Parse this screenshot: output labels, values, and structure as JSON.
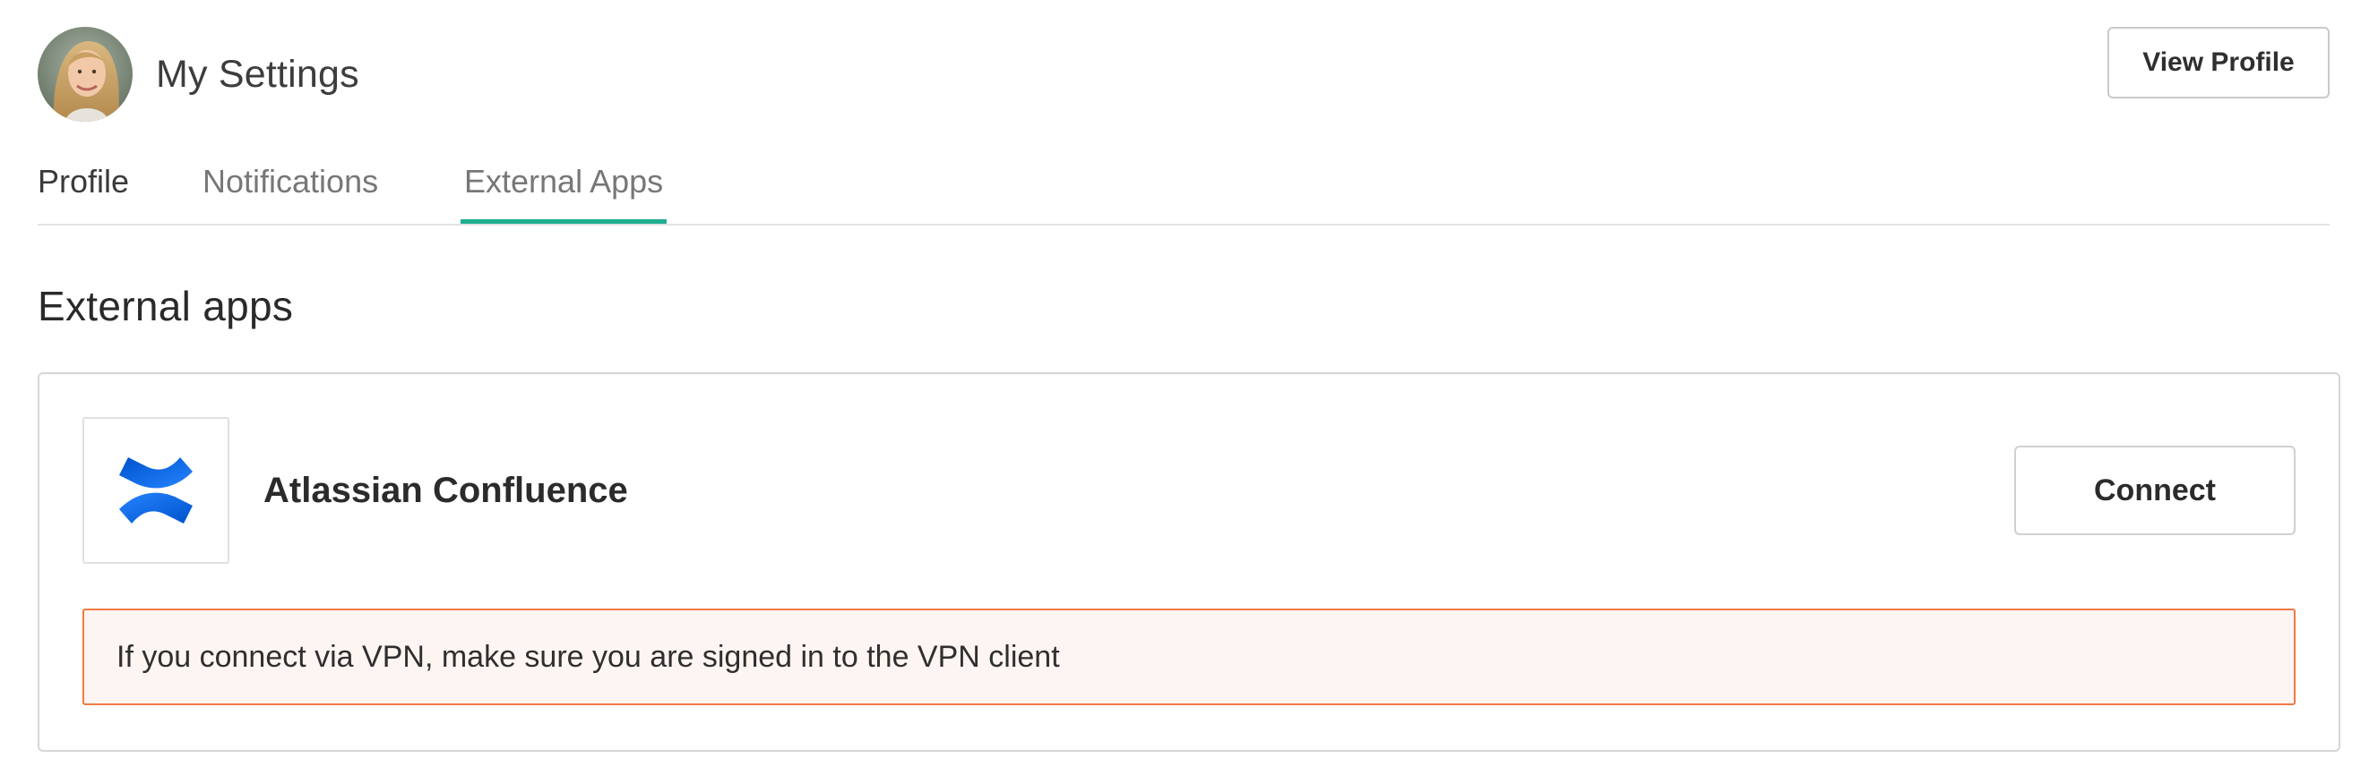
{
  "header": {
    "title": "My Settings",
    "view_profile_label": "View Profile"
  },
  "tabs": [
    {
      "label": "Profile",
      "active": false
    },
    {
      "label": "Notifications",
      "active": false
    },
    {
      "label": "External Apps",
      "active": true
    }
  ],
  "section": {
    "title": "External apps"
  },
  "apps": [
    {
      "name": "Atlassian Confluence",
      "icon": "confluence-logo-icon",
      "connect_label": "Connect",
      "notice": "If you connect via VPN, make sure you are signed in to the VPN client"
    }
  ],
  "colors": {
    "tab_active_underline": "#1fae8f",
    "notice_border": "#f07a45",
    "notice_background": "#fdf5f1",
    "confluence_blue": "#1868db"
  }
}
